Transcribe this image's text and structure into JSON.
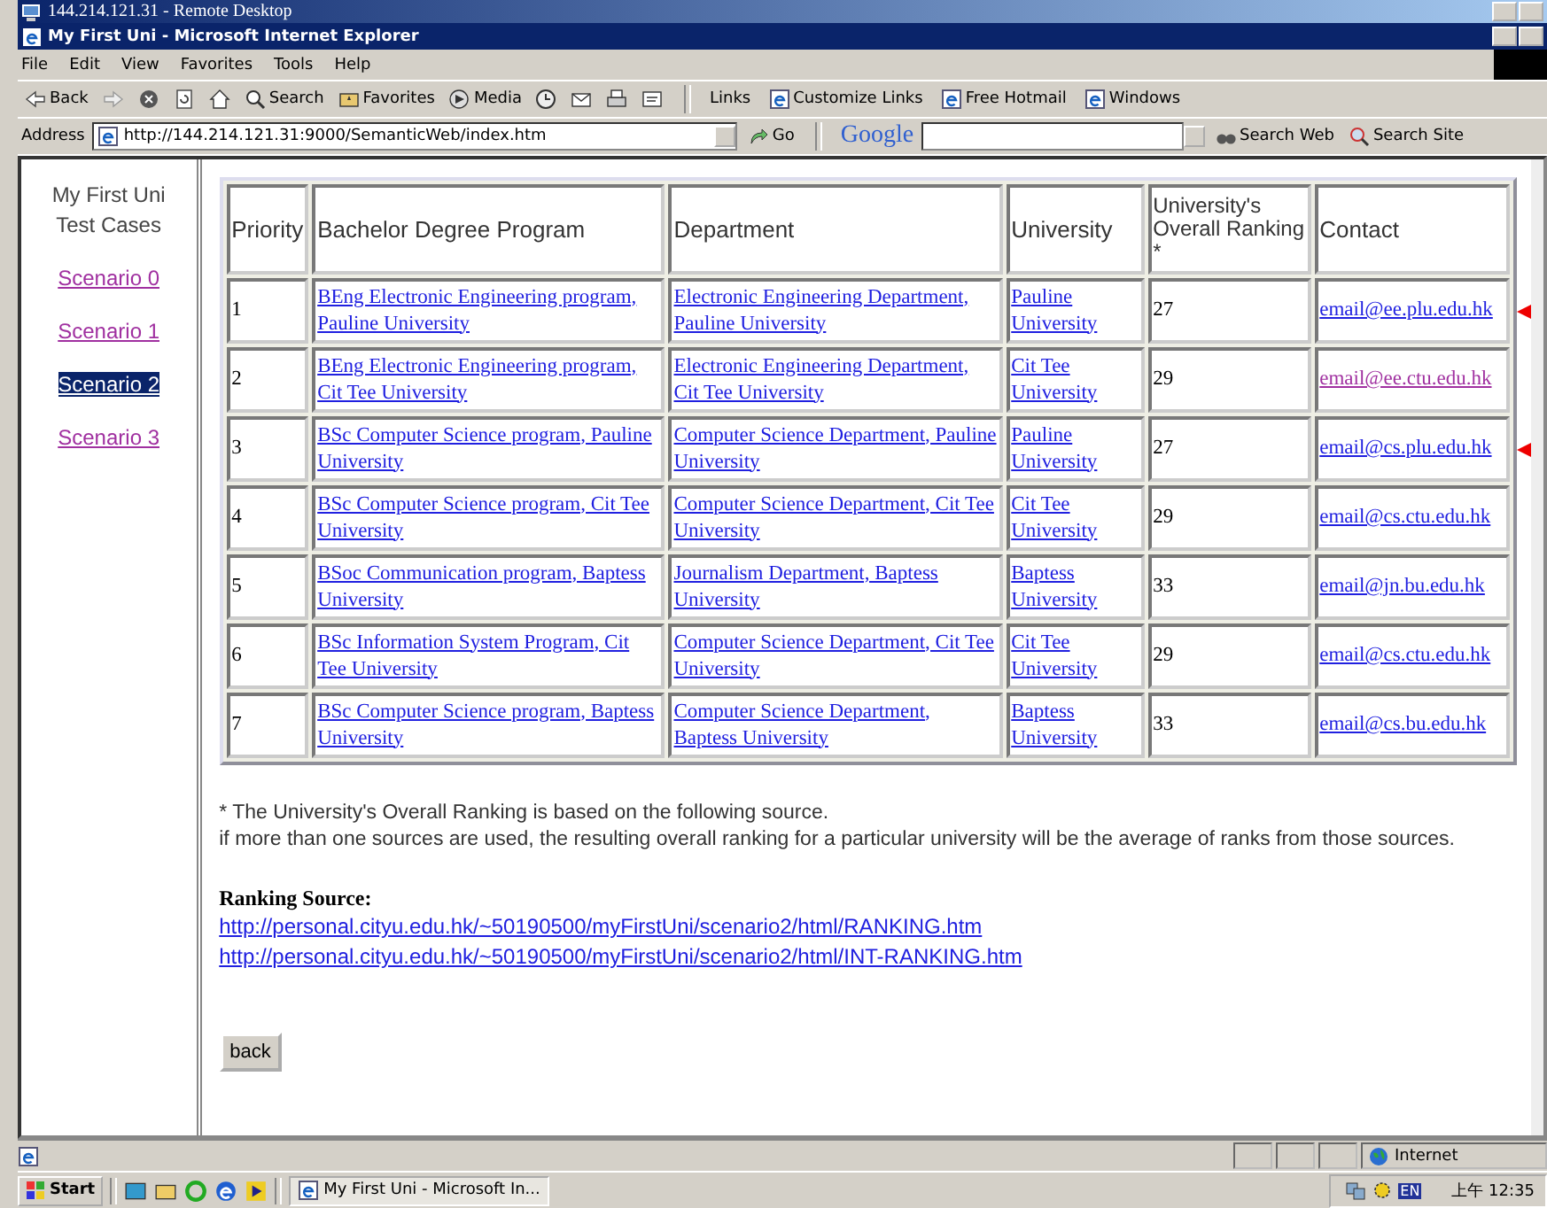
{
  "remote_window": {
    "title": "144.214.121.31 - Remote Desktop"
  },
  "browser": {
    "title": "My First Uni - Microsoft Internet Explorer",
    "menu": [
      "File",
      "Edit",
      "View",
      "Favorites",
      "Tools",
      "Help"
    ],
    "toolbar": [
      {
        "label": "Back",
        "kind": "back"
      },
      {
        "kind": "forward"
      },
      {
        "kind": "stop"
      },
      {
        "kind": "refresh"
      },
      {
        "kind": "home"
      },
      {
        "label": "Search",
        "kind": "search"
      },
      {
        "label": "Favorites",
        "kind": "favorites"
      },
      {
        "label": "Media",
        "kind": "media"
      },
      {
        "kind": "history"
      },
      {
        "kind": "mail"
      },
      {
        "kind": "print"
      },
      {
        "kind": "edit"
      }
    ],
    "links_label": "Links",
    "links": [
      "Customize Links",
      "Free Hotmail",
      "Windows"
    ],
    "address_label": "Address",
    "address": "http://144.214.121.31:9000/SemanticWeb/index.htm",
    "go": "Go",
    "google": "Google",
    "search_web": "Search Web",
    "search_site": "Search Site"
  },
  "sidebar": {
    "title": "My First Uni Test Cases",
    "items": [
      {
        "label": "Scenario 0",
        "selected": false
      },
      {
        "label": "Scenario 1",
        "selected": false
      },
      {
        "label": "Scenario 2",
        "selected": true
      },
      {
        "label": "Scenario 3",
        "selected": false
      }
    ]
  },
  "table": {
    "columns": [
      "Priority",
      "Bachelor Degree Program",
      "Department",
      "University",
      "University's Overall Ranking *",
      "Contact"
    ],
    "rows": [
      {
        "priority": "1",
        "program": "BEng Electronic Engineering program, Pauline University",
        "department": "Electronic Engineering Department, Pauline University",
        "university": "Pauline University",
        "ranking": "27",
        "contact": "email@ee.plu.edu.hk",
        "contact_visited": false,
        "flagged": true
      },
      {
        "priority": "2",
        "program": "BEng Electronic Engineering program, Cit Tee University",
        "department": "Electronic Engineering Department, Cit Tee University",
        "university": "Cit Tee University",
        "ranking": "29",
        "contact": "email@ee.ctu.edu.hk",
        "contact_visited": true,
        "flagged": false
      },
      {
        "priority": "3",
        "program": "BSc Computer Science program, Pauline University",
        "department": "Computer Science Department, Pauline University",
        "university": "Pauline University",
        "ranking": "27",
        "contact": "email@cs.plu.edu.hk",
        "contact_visited": false,
        "flagged": true
      },
      {
        "priority": "4",
        "program": "BSc Computer Science program, Cit Tee University",
        "department": "Computer Science Department, Cit Tee University",
        "university": "Cit Tee University",
        "ranking": "29",
        "contact": "email@cs.ctu.edu.hk",
        "contact_visited": false,
        "flagged": false
      },
      {
        "priority": "5",
        "program": "BSoc Communication program, Baptess University",
        "department": "Journalism Department, Baptess University",
        "university": "Baptess University",
        "ranking": "33",
        "contact": "email@jn.bu.edu.hk",
        "contact_visited": false,
        "flagged": false
      },
      {
        "priority": "6",
        "program": "BSc Information System Program, Cit Tee University",
        "department": "Computer Science Department, Cit Tee University",
        "university": "Cit Tee University",
        "ranking": "29",
        "contact": "email@cs.ctu.edu.hk",
        "contact_visited": false,
        "flagged": false
      },
      {
        "priority": "7",
        "program": "BSc Computer Science program, Baptess University",
        "department": "Computer Science Department, Baptess University",
        "university": "Baptess University",
        "ranking": "33",
        "contact": "email@cs.bu.edu.hk",
        "contact_visited": false,
        "flagged": false
      }
    ]
  },
  "notes": [
    "* The University's Overall Ranking is based on the following source.",
    "if more than one sources are used, the resulting overall ranking for a particular university will be the average of ranks from those sources."
  ],
  "ranking_source": {
    "label": "Ranking Source:",
    "links": [
      "http://personal.cityu.edu.hk/~50190500/myFirstUni/scenario2/html/RANKING.htm",
      "http://personal.cityu.edu.hk/~50190500/myFirstUni/scenario2/html/INT-RANKING.htm"
    ]
  },
  "back_button": "back",
  "status_bar": {
    "zone": "Internet"
  },
  "taskbar": {
    "start": "Start",
    "tasks": [
      "My First Uni - Microsoft In..."
    ],
    "language": "EN",
    "clock": "上午 12:35"
  }
}
